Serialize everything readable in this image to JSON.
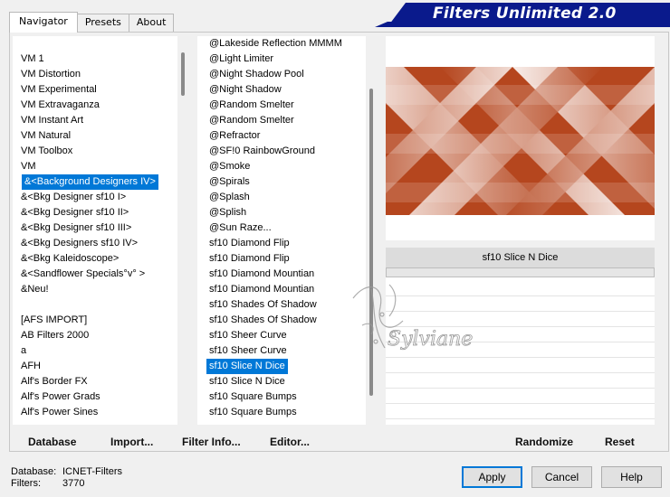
{
  "tabs": [
    {
      "label": "Navigator"
    },
    {
      "label": "Presets"
    },
    {
      "label": "About"
    }
  ],
  "banner": {
    "title": "Filters Unlimited 2.0",
    "color": "#0a1a8c"
  },
  "categories": {
    "items": [
      "VM 1",
      "VM Distortion",
      "VM Experimental",
      "VM Extravaganza",
      "VM Instant Art",
      "VM Natural",
      "VM Toolbox",
      "VM",
      "&<Background Designers IV>",
      "&<Bkg Designer sf10 I>",
      "&<Bkg Designer sf10 II>",
      "&<Bkg Designer sf10 III>",
      "&<Bkg Designers sf10 IV>",
      "&<Bkg Kaleidoscope>",
      "&<Sandflower Specials°v° >",
      "&Neu!",
      "",
      "[AFS IMPORT]",
      "AB Filters 2000",
      "a",
      "AFH",
      "Alf's Border FX",
      "Alf's Power Grads",
      "Alf's Power Sines"
    ],
    "selected_index": 8
  },
  "filters": {
    "items": [
      "@Lakeside Reflection MMMM",
      "@Light Limiter",
      "@Night Shadow Pool",
      "@Night Shadow",
      "@Random Smelter",
      "@Random Smelter",
      "@Refractor",
      "@SF!0 RainbowGround",
      "@Smoke",
      "@Spirals",
      "@Splash",
      "@Splish",
      "@Sun Raze...",
      "sf10 Diamond Flip",
      "sf10 Diamond Flip",
      "sf10 Diamond Mountian",
      "sf10 Diamond Mountian",
      "sf10 Shades Of Shadow",
      "sf10 Shades Of Shadow",
      "sf10 Sheer Curve",
      "sf10 Sheer Curve",
      "sf10 Slice N Dice",
      "sf10 Slice N Dice",
      "sf10 Square Bumps",
      "sf10 Square Bumps"
    ],
    "selected_index": 21
  },
  "preview": {
    "filter_name": "sf10 Slice N Dice",
    "accent": "#b5461e"
  },
  "watermark": {
    "text": "Sylviane"
  },
  "actions": {
    "database": "Database",
    "import": "Import...",
    "filter_info": "Filter Info...",
    "editor": "Editor...",
    "randomize": "Randomize",
    "reset": "Reset"
  },
  "status": {
    "database_label": "Database:",
    "database_value": "ICNET-Filters",
    "filters_label": "Filters:",
    "filters_value": "3770"
  },
  "dialog": {
    "apply": "Apply",
    "cancel": "Cancel",
    "help": "Help"
  }
}
